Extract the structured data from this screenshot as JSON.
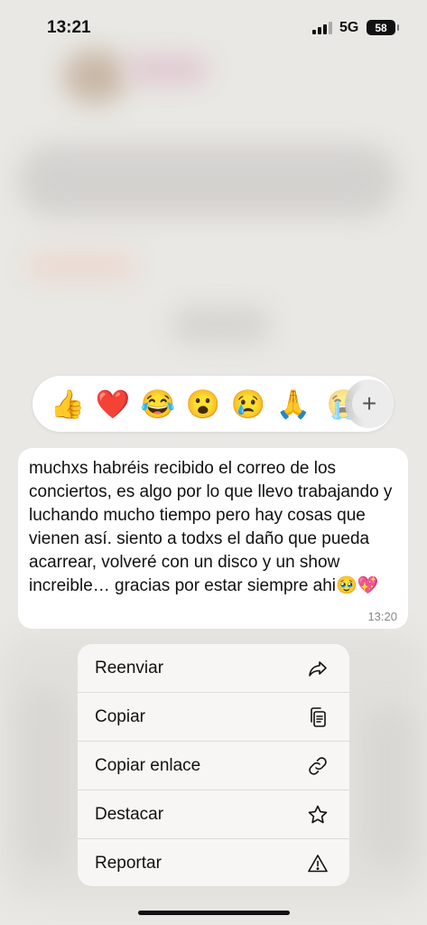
{
  "status_bar": {
    "time": "13:21",
    "network": "5G",
    "battery": "58"
  },
  "reactions": {
    "emojis": [
      "👍",
      "❤️",
      "😂",
      "😮",
      "😢",
      "🙏",
      "😭"
    ],
    "more_symbol": "+"
  },
  "message": {
    "text": "muchxs habréis recibido el correo de los conciertos, es algo por lo que llevo trabajando y luchando mucho tiempo pero hay cosas que vienen así. siento a todxs el daño que pueda acarrear, volveré con un disco y un show increible… gracias por estar siempre ahi🥹💖",
    "time": "13:20"
  },
  "menu": {
    "items": [
      {
        "label": "Reenviar",
        "icon": "share-arrow-icon"
      },
      {
        "label": "Copiar",
        "icon": "copy-icon"
      },
      {
        "label": "Copiar enlace",
        "icon": "link-icon"
      },
      {
        "label": "Destacar",
        "icon": "star-icon"
      },
      {
        "label": "Reportar",
        "icon": "warning-icon"
      }
    ]
  }
}
